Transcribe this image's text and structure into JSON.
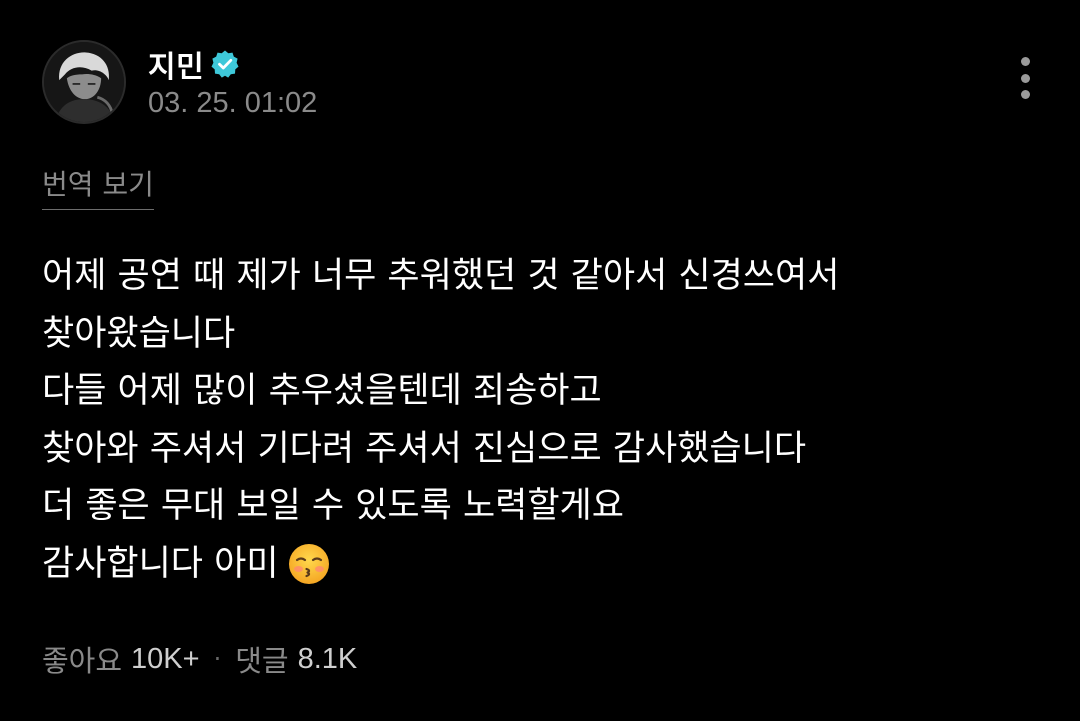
{
  "post": {
    "author": "지민",
    "timestamp": "03. 25. 01:02",
    "translate_label": "번역 보기",
    "lines": [
      "어제 공연 때 제가 너무 추워했던 것 같아서 신경쓰여서",
      "찾아왔습니다",
      "다들 어제 많이 추우셨을텐데 죄송하고",
      "찾아와 주셔서 기다려 주셔서 진심으로 감사했습니다",
      "더 좋은 무대 보일 수 있도록 노력할게요",
      "감사합니다 아미"
    ],
    "emoji": "kissing-face-with-closed-eyes"
  },
  "stats": {
    "likes_label": "좋아요",
    "likes_count": "10K+",
    "separator": "·",
    "comments_label": "댓글",
    "comments_count": "8.1K"
  },
  "icons": {
    "verified": "verified-badge-icon",
    "more": "more-vertical-icon"
  },
  "colors": {
    "background": "#000000",
    "verified": "#3ec8d9",
    "muted_text": "#8a8a8a"
  }
}
